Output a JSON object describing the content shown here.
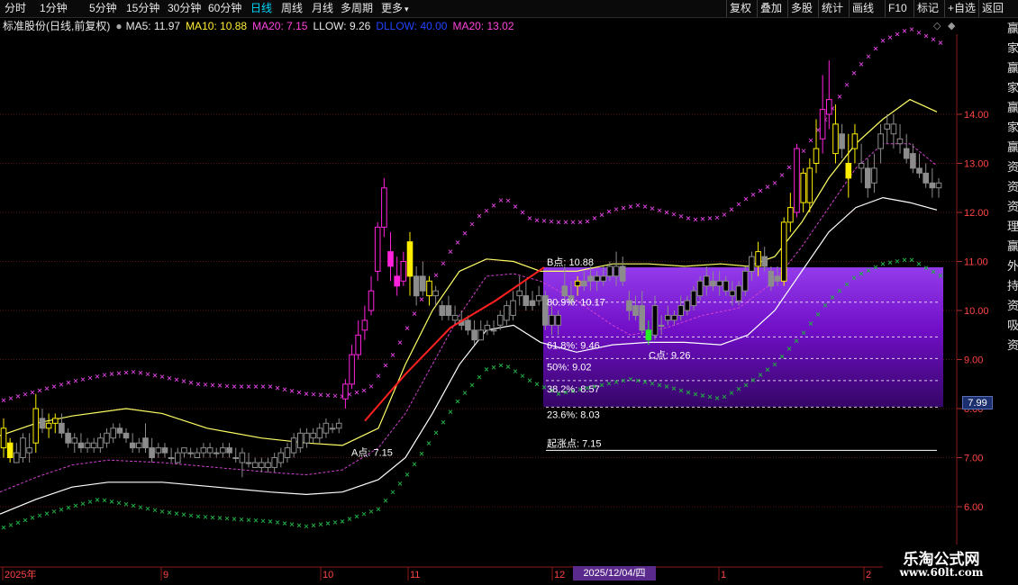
{
  "toolbar": {
    "periods": [
      "分时",
      "1分钟",
      "5分钟",
      "15分钟",
      "30分钟",
      "60分钟",
      "日线",
      "周线",
      "月线",
      "多周期",
      "更多"
    ],
    "active_period": "日线",
    "more_arrow": "▾",
    "actions": [
      "复权",
      "叠加",
      "多股",
      "统计",
      "画线",
      "F10",
      "标记",
      "+自选",
      "返回"
    ]
  },
  "infobar": {
    "stock": "标准股份(日线,前复权)",
    "ma5": "MA5: 11.97",
    "ma10": "MA10: 10.88",
    "ma20": "MA20: 7.15",
    "llow": "LLOW: 9.26",
    "dllow": "DLLOW: 40.00",
    "ma20b": "MA20: 13.02"
  },
  "colors": {
    "up_yellow": "#ffee00",
    "magenta": "#ff22dd",
    "gray": "#8c8c8c",
    "green": "#22ee22",
    "red_line": "#ff2020",
    "purple_zone": "#8a2be2",
    "ma5": "#ffff66",
    "lower_band": "#ffffff",
    "upper_dots": "#d040d0",
    "lower_dots": "#22aa44"
  },
  "y_axis": [
    "14.00",
    "13.00",
    "12.00",
    "11.00",
    "10.00",
    "9.00",
    "8.00",
    "7.00",
    "6.00"
  ],
  "right_column_chars": [
    "赢",
    "家",
    "赢",
    "家",
    "赢",
    "家",
    "赢",
    "资",
    "资",
    "资",
    "理",
    "赢",
    "外",
    "持",
    "资",
    "吸",
    "资"
  ],
  "price_badge": "7.99",
  "fib": {
    "b_point": "B点: 10.88",
    "f80": "80.9%: 10.17",
    "f618": "61.8%: 9.46",
    "f50": "50%: 9.02",
    "f382": "38.2%: 8.57",
    "f236": "23.6%: 8.03",
    "start": "起涨点: 7.15",
    "a_point": "A点: 7.15",
    "c_point": "C点: 9.26"
  },
  "x_axis": [
    "2025年",
    "9",
    "10",
    "11",
    "12",
    "1",
    "2"
  ],
  "date_badge": "2025/12/04/四",
  "watermark": {
    "title": "乐淘公式网",
    "url": "www.60lt.com"
  },
  "chart_data": {
    "type": "candlestick",
    "ylim": [
      5.5,
      15.5
    ],
    "y_ticks": [
      6,
      7,
      8,
      9,
      10,
      11,
      12,
      13,
      14
    ],
    "series": [
      {
        "name": "MA5",
        "value": 11.97
      },
      {
        "name": "MA10",
        "value": 10.88
      },
      {
        "name": "MA20",
        "value": 7.15
      },
      {
        "name": "LLOW",
        "value": 9.26
      },
      {
        "name": "DLLOW",
        "value": 40.0
      },
      {
        "name": "MA20",
        "value": 13.02
      }
    ],
    "fibonacci_levels": [
      {
        "label": "B点",
        "value": 10.88
      },
      {
        "label": "80.9%",
        "value": 10.17
      },
      {
        "label": "61.8%",
        "value": 9.46
      },
      {
        "label": "50%",
        "value": 9.02
      },
      {
        "label": "38.2%",
        "value": 8.57
      },
      {
        "label": "23.6%",
        "value": 8.03
      },
      {
        "label": "起涨点",
        "value": 7.15
      }
    ],
    "points": {
      "A": 7.15,
      "B": 10.88,
      "C": 9.26
    },
    "candles": [
      [
        7.2,
        7.8,
        7.0,
        7.6,
        "y"
      ],
      [
        7.3,
        7.4,
        6.9,
        7.0,
        "y"
      ],
      [
        6.9,
        7.3,
        6.9,
        7.1,
        "g"
      ],
      [
        7.0,
        7.5,
        6.9,
        7.4,
        "g"
      ],
      [
        7.1,
        7.5,
        6.9,
        7.2,
        "g"
      ],
      [
        7.3,
        8.3,
        7.1,
        8.0,
        "y"
      ],
      [
        7.8,
        8.0,
        7.5,
        7.6,
        "g"
      ],
      [
        7.6,
        7.9,
        7.4,
        7.7,
        "y"
      ],
      [
        7.7,
        7.9,
        7.5,
        7.8,
        "y"
      ],
      [
        7.7,
        7.9,
        7.4,
        7.5,
        "g"
      ],
      [
        7.5,
        7.6,
        7.2,
        7.3,
        "g"
      ],
      [
        7.3,
        7.5,
        7.1,
        7.4,
        "g"
      ],
      [
        7.3,
        7.5,
        7.1,
        7.2,
        "g"
      ],
      [
        7.2,
        7.4,
        7.1,
        7.3,
        "g"
      ],
      [
        7.2,
        7.4,
        7.1,
        7.3,
        "g"
      ],
      [
        7.2,
        7.5,
        7.1,
        7.4,
        "g"
      ],
      [
        7.3,
        7.6,
        7.2,
        7.5,
        "g"
      ],
      [
        7.4,
        7.7,
        7.3,
        7.6,
        "g"
      ],
      [
        7.6,
        7.7,
        7.4,
        7.5,
        "g"
      ],
      [
        7.5,
        7.6,
        7.3,
        7.4,
        "g"
      ],
      [
        7.3,
        7.5,
        7.1,
        7.2,
        "g"
      ],
      [
        7.2,
        7.4,
        7.1,
        7.3,
        "g"
      ],
      [
        7.4,
        7.7,
        7.1,
        7.2,
        "g"
      ],
      [
        7.2,
        7.4,
        6.9,
        7.0,
        "g"
      ],
      [
        7.1,
        7.3,
        7.0,
        7.2,
        "g"
      ],
      [
        7.2,
        7.3,
        7.0,
        7.1,
        "g"
      ],
      [
        7.0,
        7.2,
        6.9,
        7.0,
        "g"
      ],
      [
        6.9,
        7.2,
        6.9,
        7.1,
        "g"
      ],
      [
        7.1,
        7.2,
        7.0,
        7.2,
        "g"
      ],
      [
        7.1,
        7.2,
        7.0,
        7.1,
        "g"
      ],
      [
        7.0,
        7.2,
        7.0,
        7.1,
        "g"
      ],
      [
        7.1,
        7.3,
        7.0,
        7.2,
        "g"
      ],
      [
        7.1,
        7.3,
        7.0,
        7.2,
        "g"
      ],
      [
        7.1,
        7.2,
        7.0,
        7.1,
        "g"
      ],
      [
        7.1,
        7.3,
        7.0,
        7.2,
        "g"
      ],
      [
        7.2,
        7.3,
        7.0,
        7.1,
        "g"
      ],
      [
        7.0,
        7.2,
        6.9,
        7.0,
        "g"
      ],
      [
        6.9,
        7.2,
        6.6,
        7.1,
        "g"
      ],
      [
        6.9,
        7.1,
        6.8,
        6.9,
        "g"
      ],
      [
        6.8,
        7.0,
        6.8,
        6.9,
        "g"
      ],
      [
        6.8,
        7.0,
        6.7,
        6.9,
        "g"
      ],
      [
        6.8,
        7.0,
        6.7,
        6.9,
        "g"
      ],
      [
        6.8,
        7.1,
        6.7,
        7.0,
        "g"
      ],
      [
        6.9,
        7.2,
        6.8,
        7.1,
        "g"
      ],
      [
        7.0,
        7.3,
        6.9,
        7.2,
        "g"
      ],
      [
        7.1,
        7.5,
        7.0,
        7.4,
        "g"
      ],
      [
        7.2,
        7.6,
        7.1,
        7.5,
        "g"
      ],
      [
        7.3,
        7.6,
        7.2,
        7.5,
        "g"
      ],
      [
        7.4,
        7.6,
        7.3,
        7.5,
        "g"
      ],
      [
        7.4,
        7.7,
        7.3,
        7.6,
        "g"
      ],
      [
        7.5,
        7.8,
        7.4,
        7.7,
        "g"
      ],
      [
        7.6,
        7.7,
        7.5,
        7.6,
        "g"
      ],
      [
        7.6,
        7.8,
        7.5,
        7.7,
        "g"
      ],
      [
        8.2,
        8.6,
        8.0,
        8.5,
        "m"
      ],
      [
        8.5,
        9.3,
        8.4,
        9.1,
        "m"
      ],
      [
        9.1,
        9.8,
        9.0,
        9.5,
        "m"
      ],
      [
        9.6,
        10.1,
        9.4,
        9.8,
        "m"
      ],
      [
        10.0,
        10.7,
        9.9,
        10.4,
        "m"
      ],
      [
        10.8,
        11.8,
        10.6,
        11.7,
        "m"
      ],
      [
        11.7,
        12.7,
        11.5,
        12.5,
        "m"
      ],
      [
        11.2,
        11.6,
        10.6,
        10.9,
        "m"
      ],
      [
        10.7,
        11.1,
        10.3,
        10.5,
        "m"
      ],
      [
        10.6,
        11.2,
        10.5,
        11.0,
        "m"
      ],
      [
        11.4,
        11.6,
        10.3,
        10.7,
        "y"
      ],
      [
        10.7,
        10.9,
        10.1,
        10.3,
        "g"
      ],
      [
        10.7,
        11.0,
        10.3,
        10.4,
        "g"
      ],
      [
        10.3,
        10.7,
        10.1,
        10.6,
        "y"
      ],
      [
        10.3,
        10.5,
        10.1,
        10.4,
        "g"
      ],
      [
        10.1,
        10.2,
        9.8,
        9.9,
        "g"
      ],
      [
        10.1,
        10.3,
        9.8,
        9.9,
        "g"
      ],
      [
        9.8,
        10.1,
        9.7,
        9.9,
        "g"
      ],
      [
        9.8,
        10.0,
        9.6,
        9.7,
        "g"
      ],
      [
        9.8,
        9.9,
        9.5,
        9.6,
        "g"
      ],
      [
        9.6,
        9.8,
        9.3,
        9.4,
        "g"
      ],
      [
        9.4,
        9.8,
        9.4,
        9.6,
        "g"
      ],
      [
        9.6,
        9.8,
        9.5,
        9.7,
        "g"
      ],
      [
        9.6,
        9.8,
        9.5,
        9.6,
        "g"
      ],
      [
        9.7,
        10.0,
        9.6,
        9.9,
        "g"
      ],
      [
        9.8,
        10.2,
        9.7,
        10.1,
        "g"
      ],
      [
        9.9,
        10.4,
        9.8,
        10.2,
        "g"
      ],
      [
        10.3,
        10.7,
        10.1,
        10.4,
        "g"
      ],
      [
        10.3,
        10.6,
        10.0,
        10.1,
        "g"
      ],
      [
        10.2,
        10.4,
        10.0,
        10.1,
        "g"
      ],
      [
        10.2,
        10.5,
        10.1,
        10.3,
        "g"
      ],
      [
        10.3,
        10.4,
        9.6,
        9.7,
        "g"
      ],
      [
        9.7,
        10.1,
        9.5,
        9.9,
        "g"
      ],
      [
        9.7,
        10.0,
        9.5,
        9.9,
        "g"
      ],
      [
        10.5,
        10.9,
        10.2,
        10.3,
        "g"
      ],
      [
        10.3,
        10.6,
        10.1,
        10.2,
        "g"
      ],
      [
        10.5,
        10.7,
        10.3,
        10.6,
        "y"
      ],
      [
        10.6,
        10.8,
        10.4,
        10.5,
        "g"
      ],
      [
        10.7,
        10.9,
        10.4,
        10.6,
        "g"
      ],
      [
        10.6,
        10.8,
        10.4,
        10.7,
        "g"
      ],
      [
        10.6,
        10.9,
        10.5,
        10.7,
        "g"
      ],
      [
        10.7,
        11.0,
        10.6,
        10.9,
        "g"
      ],
      [
        10.7,
        11.2,
        10.5,
        10.9,
        "g"
      ],
      [
        10.9,
        11.1,
        10.5,
        10.6,
        "g"
      ],
      [
        10.2,
        10.4,
        9.8,
        10.0,
        "g"
      ],
      [
        10.1,
        10.3,
        9.8,
        9.9,
        "g"
      ],
      [
        10.1,
        10.4,
        9.5,
        9.6,
        "g"
      ],
      [
        9.6,
        9.8,
        9.3,
        9.4,
        "gr"
      ],
      [
        9.5,
        10.3,
        9.4,
        10.1,
        "g"
      ],
      [
        9.7,
        9.9,
        9.5,
        9.7,
        "g"
      ],
      [
        9.8,
        10.1,
        9.7,
        9.9,
        "g"
      ],
      [
        9.8,
        10.0,
        9.7,
        9.9,
        "g"
      ],
      [
        9.9,
        10.3,
        9.8,
        10.1,
        "g"
      ],
      [
        10.0,
        10.3,
        9.9,
        10.2,
        "g"
      ],
      [
        10.1,
        10.5,
        10.0,
        10.4,
        "g"
      ],
      [
        10.3,
        10.7,
        10.2,
        10.6,
        "g"
      ],
      [
        10.5,
        10.9,
        10.3,
        10.7,
        "g"
      ],
      [
        10.6,
        10.8,
        10.4,
        10.5,
        "g"
      ],
      [
        10.5,
        10.8,
        10.3,
        10.6,
        "g"
      ],
      [
        10.4,
        10.7,
        10.3,
        10.6,
        "g"
      ],
      [
        10.3,
        10.6,
        10.1,
        10.4,
        "g"
      ],
      [
        10.2,
        10.6,
        10.1,
        10.5,
        "g"
      ],
      [
        10.4,
        10.9,
        10.3,
        10.8,
        "g"
      ],
      [
        10.8,
        11.2,
        10.6,
        11.1,
        "g"
      ],
      [
        10.9,
        11.4,
        10.7,
        11.2,
        "y"
      ],
      [
        11.1,
        11.3,
        10.8,
        10.9,
        "g"
      ],
      [
        10.8,
        10.9,
        10.4,
        10.5,
        "g"
      ],
      [
        10.7,
        10.9,
        10.5,
        10.6,
        "g"
      ],
      [
        10.6,
        11.9,
        10.5,
        11.8,
        "y"
      ],
      [
        11.8,
        12.4,
        11.6,
        12.1,
        "y"
      ],
      [
        12.0,
        13.4,
        11.9,
        13.3,
        "m"
      ],
      [
        12.2,
        12.9,
        12.0,
        12.8,
        "y"
      ],
      [
        12.2,
        13.1,
        12.0,
        12.9,
        "y"
      ],
      [
        13.0,
        13.9,
        12.8,
        13.3,
        "y"
      ],
      [
        13.5,
        14.8,
        13.2,
        14.1,
        "m"
      ],
      [
        14.0,
        15.1,
        13.7,
        14.3,
        "m"
      ],
      [
        13.2,
        14.2,
        13.0,
        13.8,
        "y"
      ],
      [
        13.6,
        13.8,
        13.1,
        13.3,
        "g"
      ],
      [
        13.0,
        13.6,
        12.3,
        12.7,
        "y"
      ],
      [
        13.3,
        13.8,
        13.0,
        13.6,
        "y"
      ],
      [
        12.9,
        13.4,
        12.6,
        13.0,
        "g"
      ],
      [
        12.9,
        13.1,
        12.3,
        12.5,
        "g"
      ],
      [
        12.6,
        13.2,
        12.4,
        12.9,
        "g"
      ],
      [
        13.3,
        13.8,
        13.0,
        13.6,
        "g"
      ],
      [
        13.7,
        14.0,
        13.4,
        13.8,
        "g"
      ],
      [
        13.6,
        14.0,
        13.3,
        13.8,
        "g"
      ],
      [
        13.4,
        13.8,
        13.2,
        13.5,
        "g"
      ],
      [
        13.3,
        13.6,
        13.0,
        13.1,
        "g"
      ],
      [
        13.2,
        13.4,
        12.8,
        12.9,
        "g"
      ],
      [
        12.9,
        13.2,
        12.7,
        12.8,
        "g"
      ],
      [
        12.8,
        13.0,
        12.5,
        12.6,
        "g"
      ],
      [
        12.6,
        12.9,
        12.3,
        12.5,
        "g"
      ],
      [
        12.5,
        12.7,
        12.3,
        12.6,
        "g"
      ]
    ]
  }
}
